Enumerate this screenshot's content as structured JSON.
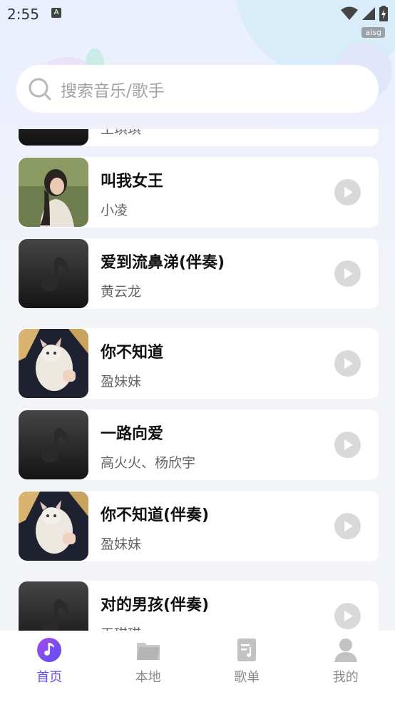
{
  "status_bar": {
    "time": "2:55",
    "watermark": "aisg"
  },
  "search": {
    "placeholder": "搜索音乐/歌手"
  },
  "songs": [
    {
      "title": "",
      "artist": "王琪琪",
      "cover": "default"
    },
    {
      "title": "叫我女王",
      "artist": "小凌",
      "cover": "girl-photo"
    },
    {
      "title": "爱到流鼻涕(伴奏)",
      "artist": "黄云龙",
      "cover": "default"
    },
    {
      "title": "你不知道",
      "artist": "盈妹妹",
      "cover": "cat-photo"
    },
    {
      "title": "一路向爱",
      "artist": "高火火、杨欣宇",
      "cover": "default"
    },
    {
      "title": "你不知道(伴奏)",
      "artist": "盈妹妹",
      "cover": "cat-photo"
    },
    {
      "title": "对的男孩(伴奏)",
      "artist": "王琪琪",
      "cover": "default"
    }
  ],
  "nav": [
    {
      "label": "首页",
      "icon": "music-note-icon",
      "active": true
    },
    {
      "label": "本地",
      "icon": "folder-icon",
      "active": false
    },
    {
      "label": "歌单",
      "icon": "playlist-icon",
      "active": false
    },
    {
      "label": "我的",
      "icon": "user-icon",
      "active": false
    }
  ],
  "colors": {
    "accent": "#6a4cf0",
    "play_button": "#d9d9d9"
  }
}
